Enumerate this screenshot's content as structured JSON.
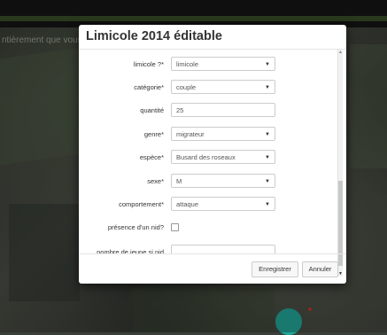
{
  "background": {
    "hint_text": "ntièrement que vous a",
    "marker_color": "#1fb3a4"
  },
  "modal": {
    "title": "Limicole 2014 éditable",
    "fields": [
      {
        "label": "limicole ?*",
        "type": "select",
        "value": "limicole"
      },
      {
        "label": "catégorie*",
        "type": "select",
        "value": "couple"
      },
      {
        "label": "quantité",
        "type": "text",
        "value": "25"
      },
      {
        "label": "genre*",
        "type": "select",
        "value": "migrateur"
      },
      {
        "label": "espèce*",
        "type": "select",
        "value": "Busard des roseaux"
      },
      {
        "label": "sexe*",
        "type": "select",
        "value": "M"
      },
      {
        "label": "comportement*",
        "type": "select",
        "value": "attaque"
      },
      {
        "label": "présence d'un nid?",
        "type": "checkbox",
        "value": ""
      },
      {
        "label": "nombre de jeune si nid",
        "type": "text",
        "value": ""
      }
    ],
    "buttons": {
      "save": "Enregistrer",
      "cancel": "Annuler"
    }
  }
}
